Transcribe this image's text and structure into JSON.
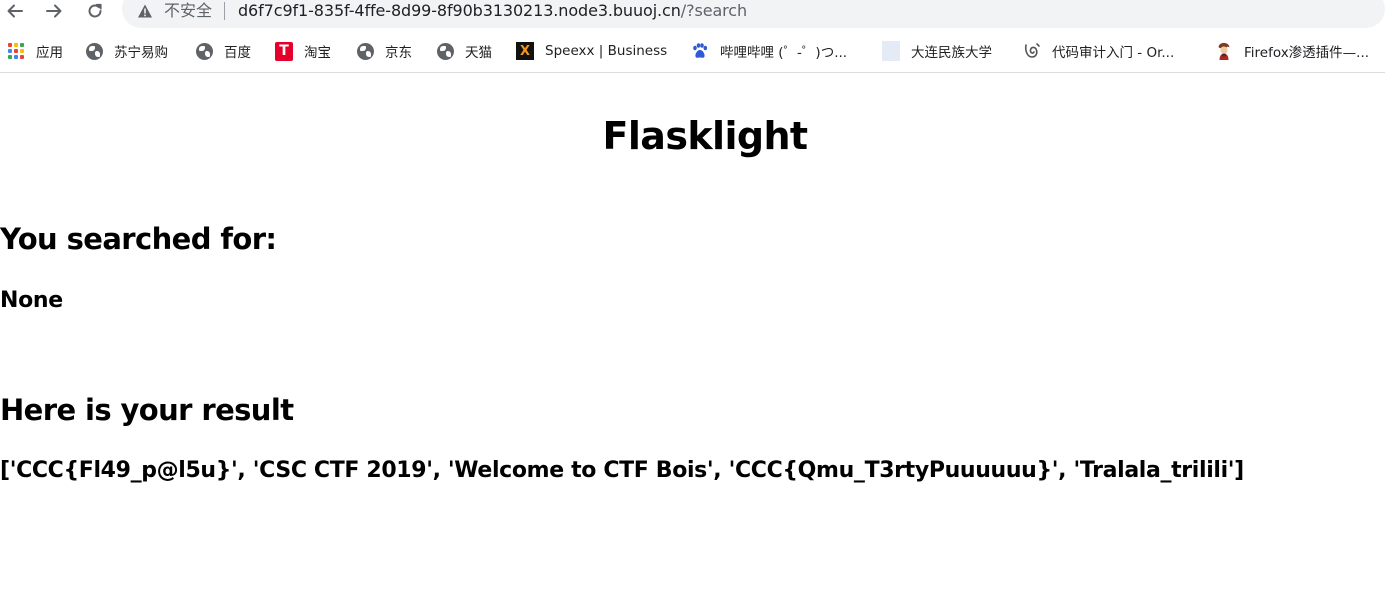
{
  "browser": {
    "nav": {
      "back_icon": "arrow-left-icon",
      "forward_icon": "arrow-right-icon",
      "reload_icon": "reload-icon"
    },
    "address_bar": {
      "security_label": "不安全",
      "host": "d6f7c9f1-835f-4ffe-8d99-8f90b3130213.node3.buuoj.cn",
      "path": "/?search",
      "warning_icon": "warning-triangle-icon"
    },
    "bookmarks": [
      {
        "label": "应用",
        "icon": "apps-grid-icon"
      },
      {
        "label": "苏宁易购",
        "icon": "globe-icon"
      },
      {
        "label": "百度",
        "icon": "globe-icon"
      },
      {
        "label": "淘宝",
        "icon": "taobao-icon"
      },
      {
        "label": "京东",
        "icon": "globe-icon"
      },
      {
        "label": "天猫",
        "icon": "globe-icon"
      },
      {
        "label": "Speexx | Business",
        "icon": "speexx-icon"
      },
      {
        "label": "哔哩哔哩 (゜-゜)つ...",
        "icon": "baidu-paw-icon"
      },
      {
        "label": "大连民族大学",
        "icon": "blank-page-icon"
      },
      {
        "label": "代码审计入门 - Or...",
        "icon": "code-audit-icon"
      },
      {
        "label": "Firefox渗透插件—...",
        "icon": "firefox-avatar-icon"
      }
    ],
    "apps_colors": [
      "#ea4335",
      "#fbbc04",
      "#34a853",
      "#4285f4",
      "#ea4335",
      "#fbbc04",
      "#34a853",
      "#4285f4",
      "#ea4335"
    ]
  },
  "page": {
    "title": "Flasklight",
    "searched_heading": "You searched for:",
    "searched_value": "None",
    "result_heading": "Here is your result",
    "result_value": "['CCC{Fl49_p@l5u}', 'CSC CTF 2019', 'Welcome to CTF Bois', 'CCC{Qmu_T3rtyPuuuuuu}', 'Tralala_trilili']"
  }
}
